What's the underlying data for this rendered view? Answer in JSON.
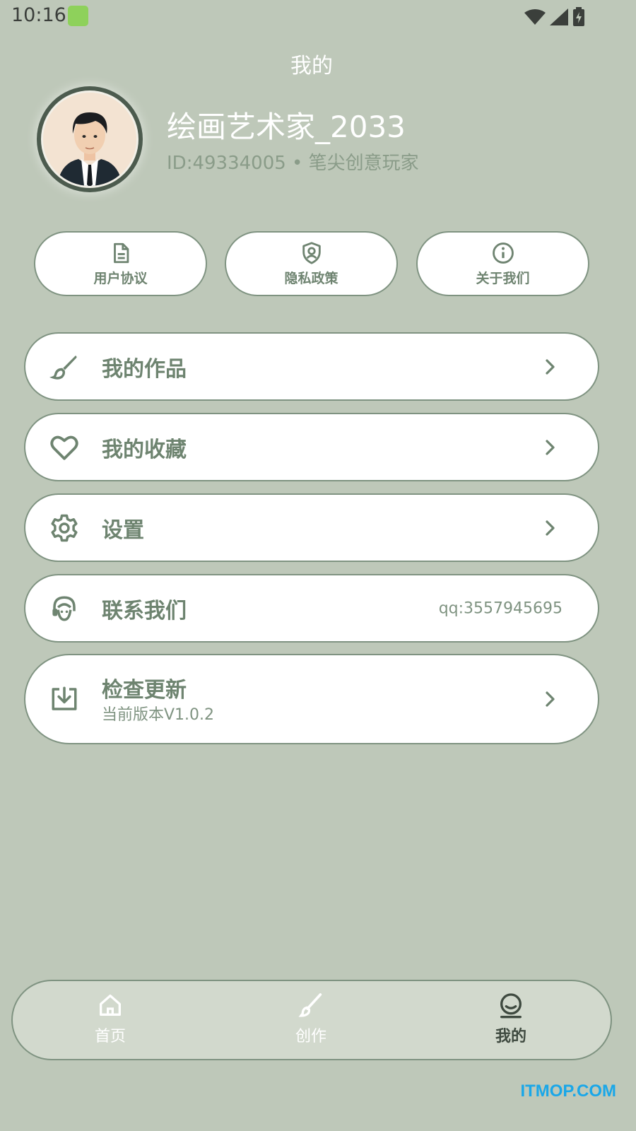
{
  "status_bar": {
    "time": "10:16"
  },
  "header": {
    "title": "我的"
  },
  "profile": {
    "username": "绘画艺术家_2033",
    "id_line": "ID:49334005 • 笔尖创意玩家"
  },
  "quick_links": [
    {
      "label": "用户协议",
      "icon": "document-icon"
    },
    {
      "label": "隐私政策",
      "icon": "shield-icon"
    },
    {
      "label": "关于我们",
      "icon": "info-icon"
    }
  ],
  "menu": [
    {
      "label": "我的作品",
      "icon": "brush-icon"
    },
    {
      "label": "我的收藏",
      "icon": "heart-icon"
    },
    {
      "label": "设置",
      "icon": "gear-icon"
    },
    {
      "label": "联系我们",
      "icon": "headset-icon",
      "right_text": "qq:3557945695"
    },
    {
      "label": "检查更新",
      "icon": "download-icon",
      "subtitle": "当前版本V1.0.2"
    }
  ],
  "bottom_nav": [
    {
      "label": "首页",
      "icon": "home-icon"
    },
    {
      "label": "创作",
      "icon": "brush-icon"
    },
    {
      "label": "我的",
      "icon": "profile-icon",
      "active": true
    }
  ],
  "watermark": "ITMOP.COM",
  "colors": {
    "background": "#bec8b9",
    "accent": "#6e8470",
    "card": "#ffffff",
    "border": "#7f9381"
  }
}
